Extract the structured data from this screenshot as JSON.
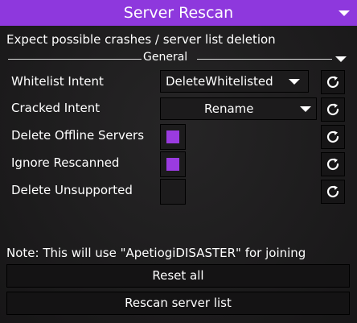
{
  "window": {
    "title": "Server Rescan",
    "warning": "Expect possible crashes / server list deletion",
    "note": "Note: This will use \"ApetiogiDISASTER\" for joining"
  },
  "section": {
    "label": "General"
  },
  "settings": {
    "whitelist_intent": {
      "label": "Whitelist Intent",
      "value": "DeleteWhitelisted"
    },
    "cracked_intent": {
      "label": "Cracked Intent",
      "value": "Rename"
    },
    "delete_offline": {
      "label": "Delete Offline Servers",
      "checked": true
    },
    "ignore_rescanned": {
      "label": "Ignore Rescanned",
      "checked": true
    },
    "delete_unsupported": {
      "label": "Delete Unsupported",
      "checked": false
    }
  },
  "buttons": {
    "reset_all": "Reset all",
    "rescan": "Rescan server list"
  },
  "colors": {
    "accent": "#8e38dd",
    "checkbox_fill": "#9a3be0",
    "background": "#1d1c1d"
  },
  "icons": {
    "collapse": "chevron-down-icon",
    "reset": "reset-icon"
  }
}
